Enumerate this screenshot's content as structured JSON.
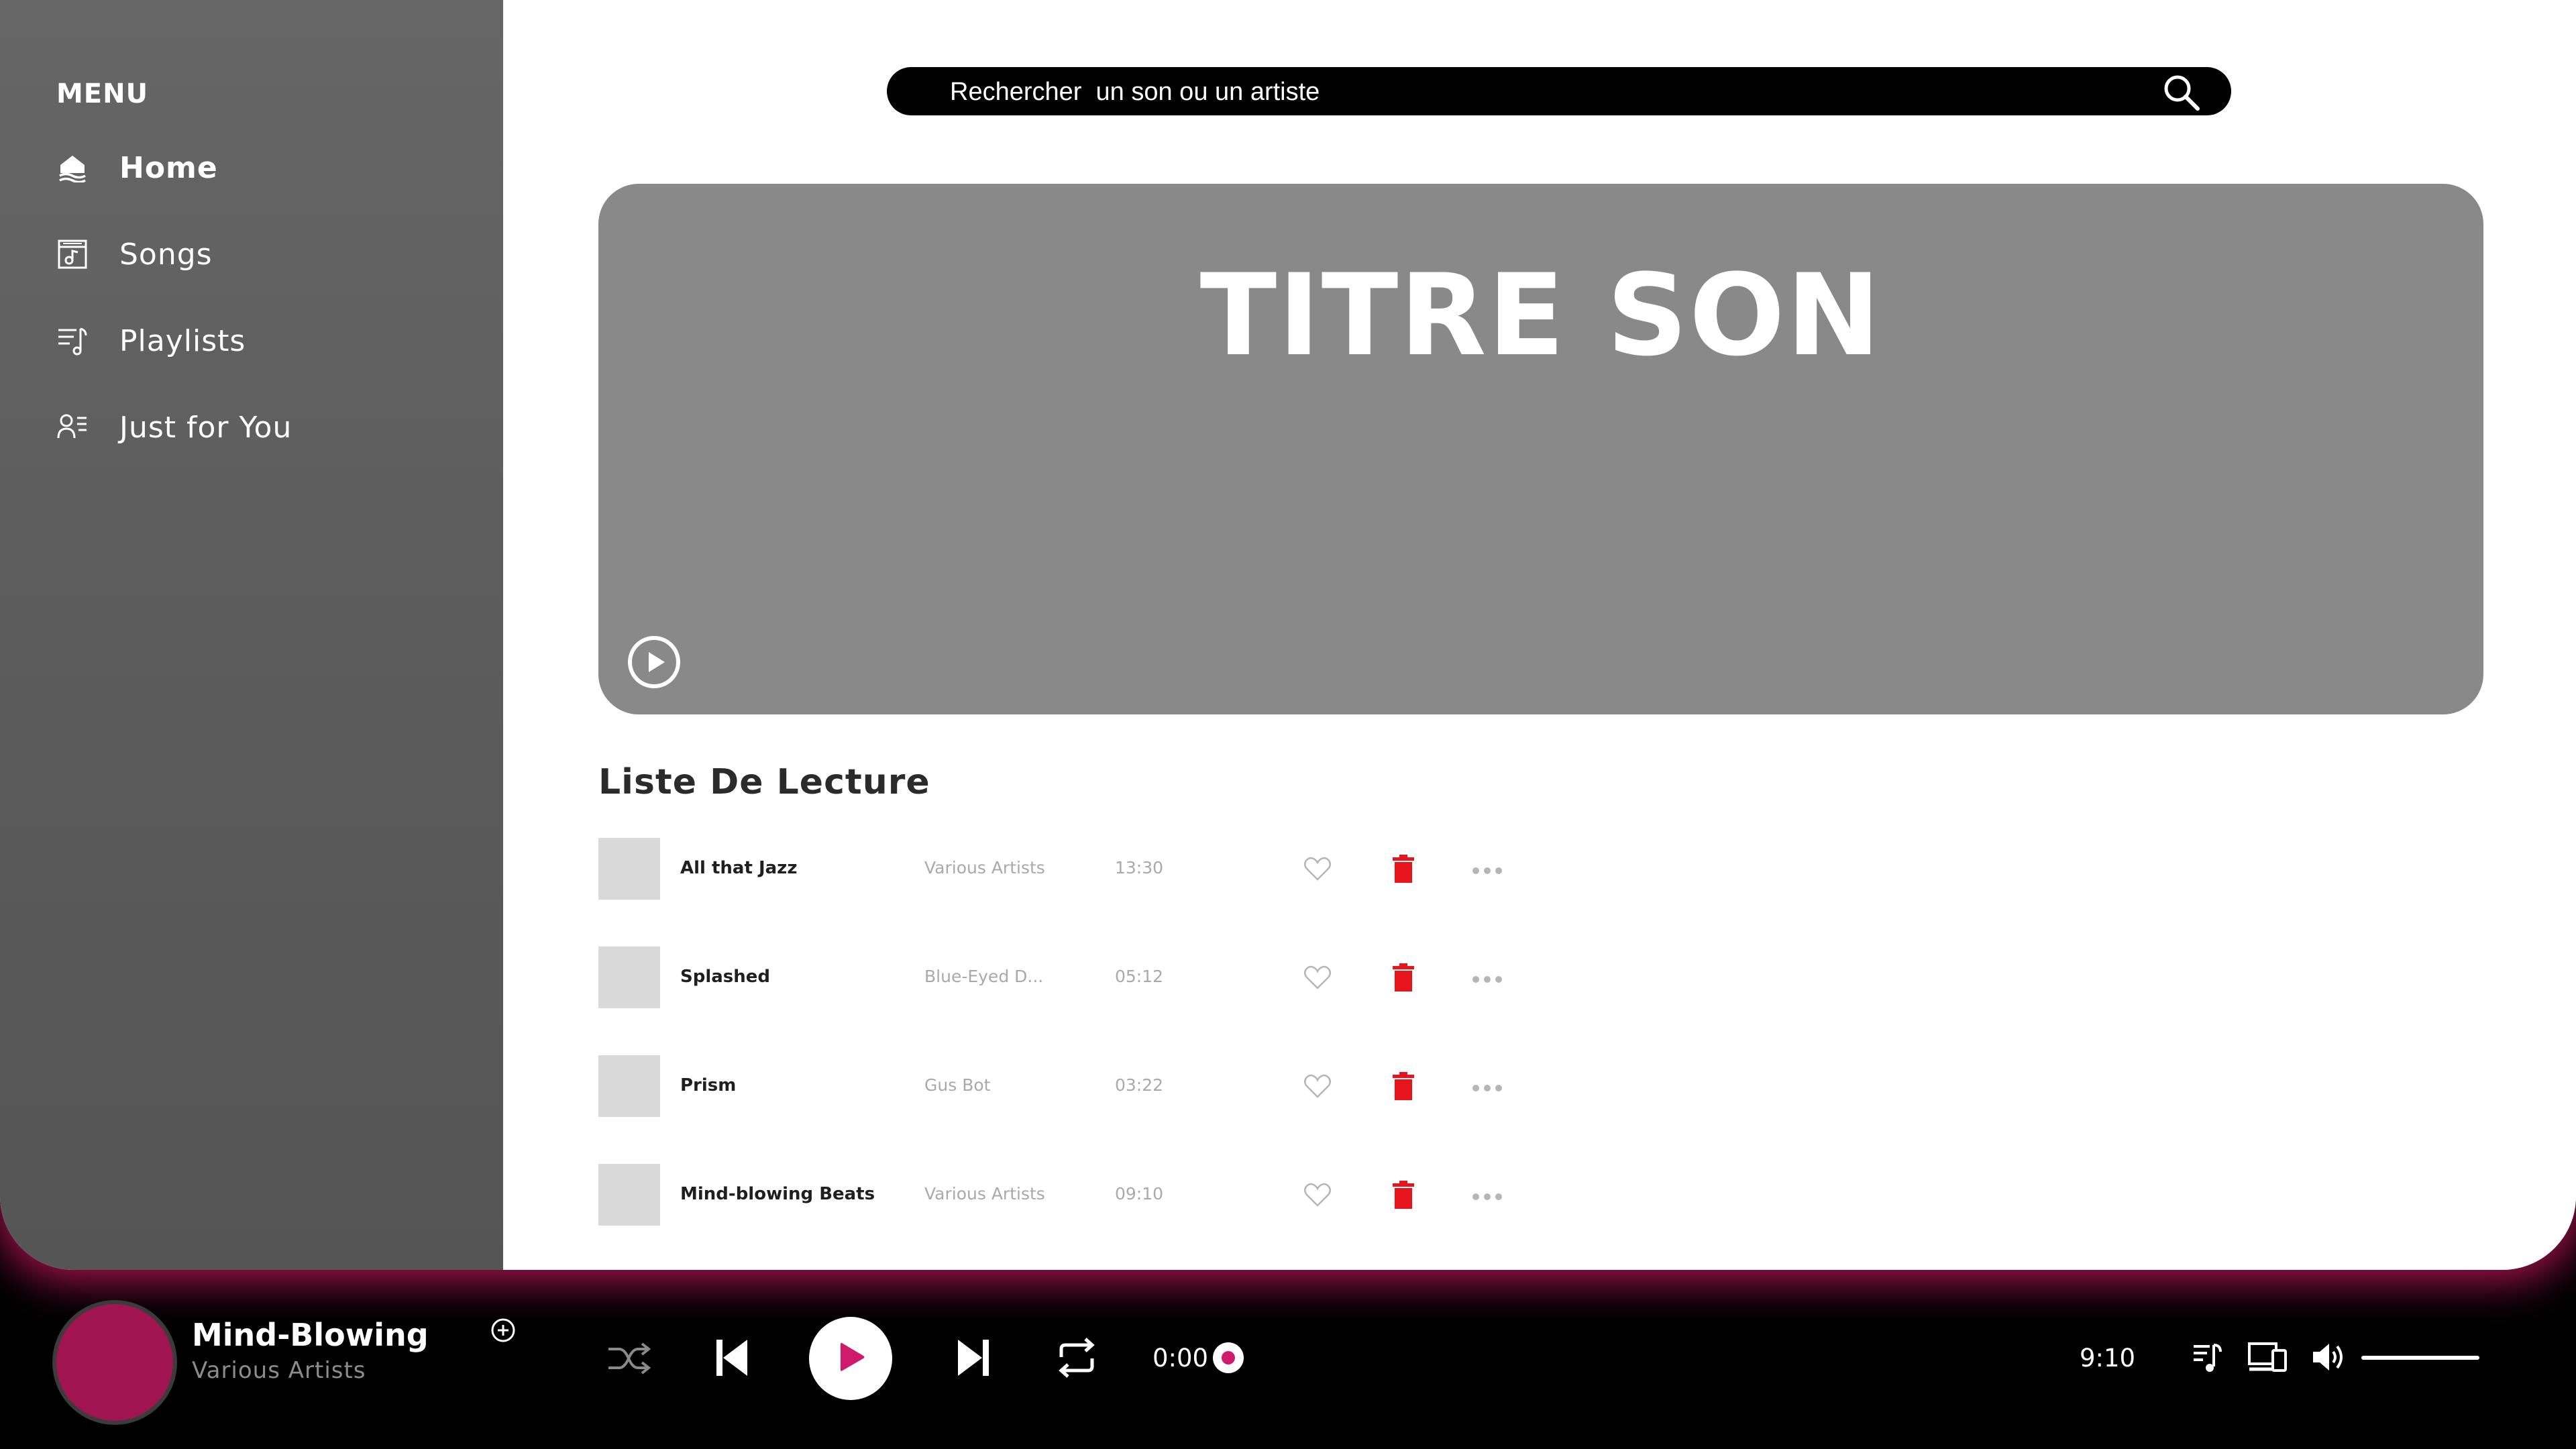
{
  "sidebar": {
    "menu_title": "MENU",
    "items": [
      {
        "label": "Home",
        "icon": "home-icon",
        "active": true
      },
      {
        "label": "Songs",
        "icon": "songs-icon",
        "active": false
      },
      {
        "label": "Playlists",
        "icon": "playlists-icon",
        "active": false
      },
      {
        "label": "Just for You",
        "icon": "just-for-you-icon",
        "active": false
      }
    ]
  },
  "search": {
    "placeholder": "Rechercher  un son ou un artiste",
    "icon": "search-icon"
  },
  "hero": {
    "title": "TITRE SON",
    "icon": "play-circle-icon"
  },
  "playlist": {
    "title": "Liste De Lecture",
    "tracks": [
      {
        "name": "All that Jazz",
        "artist": "Various Artists",
        "duration": "13:30"
      },
      {
        "name": "Splashed",
        "artist": "Blue-Eyed D...",
        "duration": "05:12"
      },
      {
        "name": "Prism",
        "artist": "Gus Bot",
        "duration": "03:22"
      },
      {
        "name": "Mind-blowing Beats",
        "artist": "Various Artists",
        "duration": "09:10"
      }
    ],
    "colors": {
      "delete": "#e8141b",
      "like": "#b5b5b5"
    }
  },
  "player": {
    "title": "Mind-Blowing",
    "artist": "Various Artists",
    "current_time": "0:00",
    "total_time": "9:10",
    "progress": 0,
    "volume": 1.0,
    "colors": {
      "accent": "#d01b6c",
      "cover": "#a01550"
    }
  }
}
